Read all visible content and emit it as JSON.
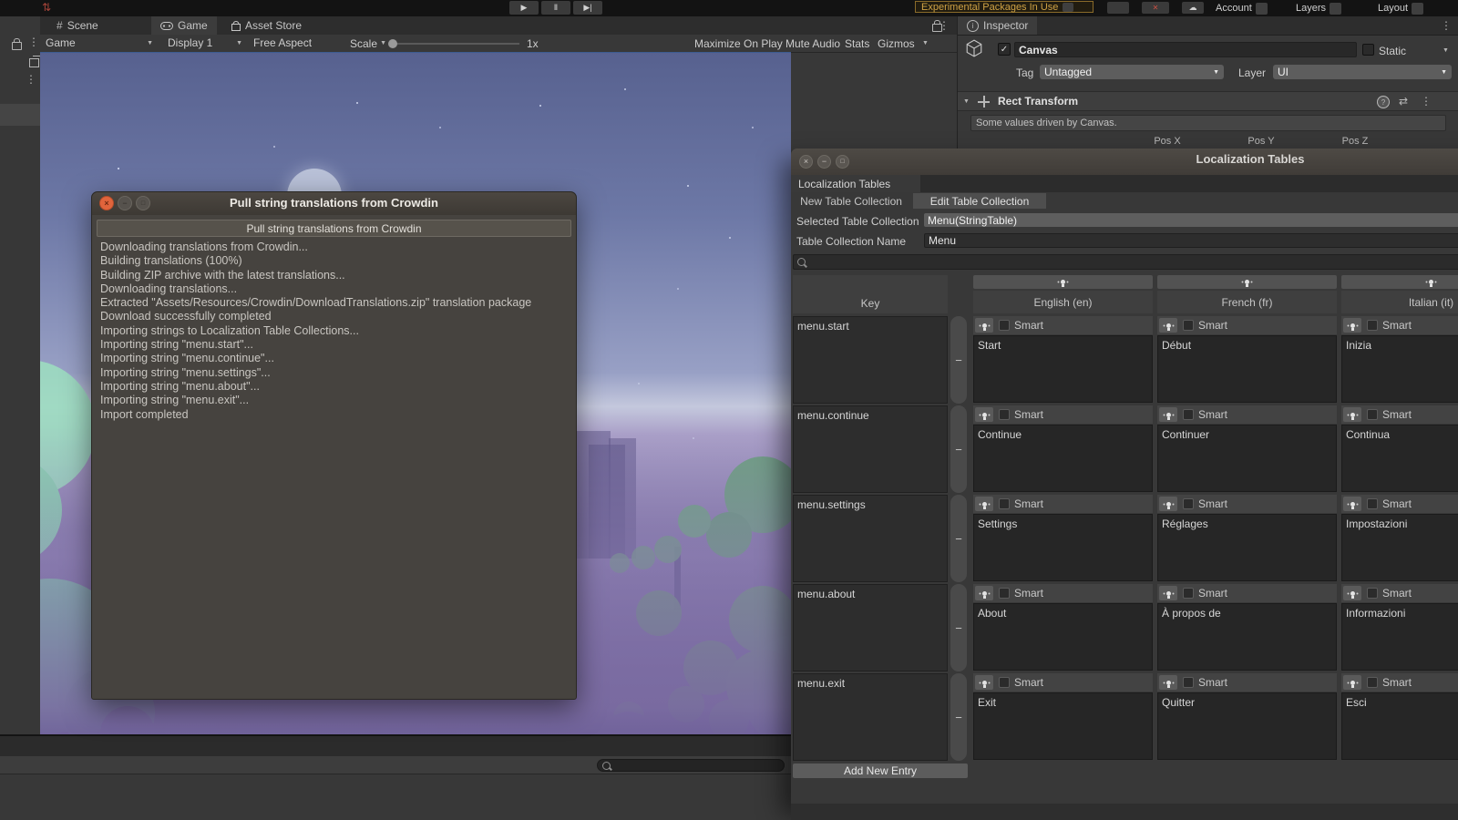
{
  "icons": {
    "play": "▶",
    "pause": "Ⅱ",
    "step": "▶|",
    "cloud": "☁",
    "kebab": "⋮",
    "arrow": "▼",
    "check": "✓",
    "win_close": "×",
    "win_min": "−",
    "win_max": "□",
    "scene_glyph": "#",
    "info_glyph": "i",
    "help_glyph": "?",
    "sliders_glyph": "⇄",
    "vcs_glyph": "⇅",
    "collab_error_glyph": "✕"
  },
  "top_toolbar": {
    "experimental_warning": "Experimental Packages In Use",
    "account_label": "Account",
    "layers_label": "Layers",
    "layout_label": "Layout"
  },
  "game_panel": {
    "tabs": [
      {
        "label": "Scene"
      },
      {
        "label": "Game"
      },
      {
        "label": "Asset Store"
      }
    ],
    "toolbar": {
      "target": "Game",
      "display": "Display 1",
      "aspect": "Free Aspect",
      "scale_label": "Scale",
      "scale_value": "1x",
      "maximize": "Maximize On Play",
      "mute": "Mute Audio",
      "stats": "Stats",
      "gizmos": "Gizmos"
    }
  },
  "inspector": {
    "tab": "Inspector",
    "object_name": "Canvas",
    "static_label": "Static",
    "tag_label": "Tag",
    "tag_value": "Untagged",
    "layer_label": "Layer",
    "layer_value": "UI",
    "rect_transform": {
      "title": "Rect Transform",
      "help": "Some values driven by Canvas.",
      "pos_x": "Pos X",
      "pos_y": "Pos Y",
      "pos_z": "Pos Z"
    }
  },
  "loc": {
    "window_title": "Localization Tables",
    "tab": "Localization Tables",
    "new_button": "New Table Collection",
    "edit_button": "Edit Table Collection",
    "selected_label": "Selected Table Collection",
    "selected_value": "Menu(StringTable)",
    "name_label": "Table Collection Name",
    "name_value": "Menu",
    "table": {
      "key_header": "Key",
      "columns": [
        "English (en)",
        "French (fr)",
        "Italian (it)"
      ],
      "smart_label": "Smart",
      "remove_label": "−",
      "rows": [
        {
          "key": "menu.start",
          "en": "Start",
          "fr": "Début",
          "it": "Inizia"
        },
        {
          "key": "menu.continue",
          "en": "Continue",
          "fr": "Continuer",
          "it": "Continua"
        },
        {
          "key": "menu.settings",
          "en": "Settings",
          "fr": "Réglages",
          "it": "Impostazioni"
        },
        {
          "key": "menu.about",
          "en": "About",
          "fr": "À propos de",
          "it": "Informazioni"
        },
        {
          "key": "menu.exit",
          "en": "Exit",
          "fr": "Quitter",
          "it": "Esci"
        }
      ],
      "add_button": "Add New Entry"
    }
  },
  "dialog": {
    "title": "Pull string translations from Crowdin",
    "action_button": "Pull string translations from Crowdin",
    "log": [
      "Downloading translations from Crowdin...",
      "Building translations (100%)",
      "Building ZIP archive with the latest translations...",
      "Downloading translations...",
      "Extracted \"Assets/Resources/Crowdin/DownloadTranslations.zip\" translation package",
      "Download successfully completed",
      "Importing strings to Localization Table Collections...",
      "Importing string \"menu.start\"...",
      "Importing string \"menu.continue\"...",
      "Importing string \"menu.settings\"...",
      "Importing string \"menu.about\"...",
      "Importing string \"menu.exit\"...",
      "Import completed"
    ]
  },
  "colors": {
    "accent_warning": "#cfa245",
    "ubuntu_close": "#e0643c",
    "panel_dark": "#383838",
    "sky_top": "#57618f",
    "horizon": "#c4c8dd",
    "fog_purple": "#7a6ca1",
    "tree_green": "#6f9e83",
    "mint_hill": "#8fd2b5"
  }
}
